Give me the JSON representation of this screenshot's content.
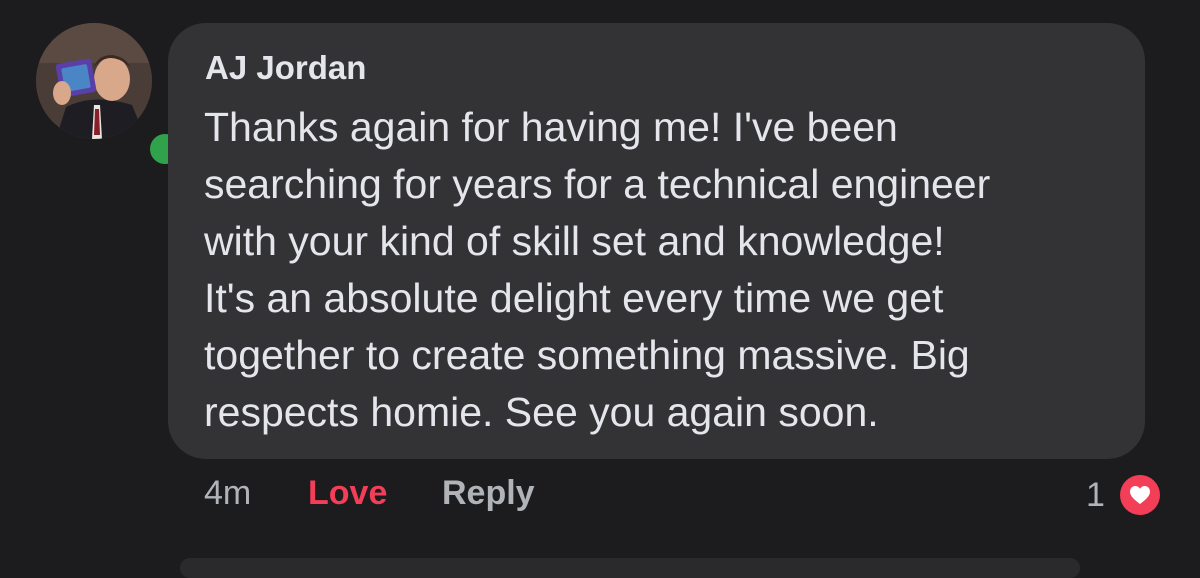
{
  "comment": {
    "author": "AJ Jordan",
    "lines": [
      "Thanks again for having me! I've been",
      "searching for years for a technical engineer",
      "with your kind of skill set and knowledge!",
      "It's an absolute delight every time we get",
      "together to create something massive. Big",
      "respects homie. See you again soon."
    ],
    "online_status_color": "#31a24c"
  },
  "actions": {
    "timestamp": "4m",
    "love_label": "Love",
    "reply_label": "Reply"
  },
  "reactions": {
    "count": "1",
    "icon": "heart-icon",
    "color": "#f33e58"
  }
}
